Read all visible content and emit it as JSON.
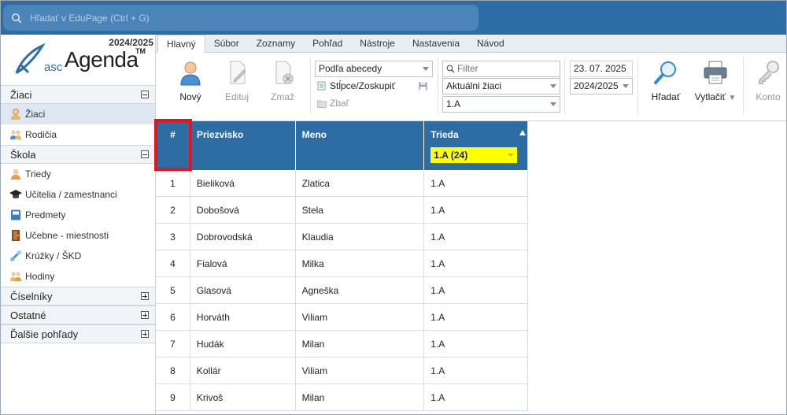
{
  "search": {
    "placeholder": "Hľadať v EduPage (Ctrl + G)"
  },
  "logo": {
    "year": "2024/2025",
    "asc": "asc",
    "agenda": "Agenda",
    "tm": "TM"
  },
  "sidebar": {
    "sections": [
      {
        "title": "Žiaci",
        "state": "minus",
        "items": [
          {
            "label": "Žiaci",
            "icon": "student-icon",
            "active": true
          },
          {
            "label": "Rodičia",
            "icon": "parents-icon"
          }
        ]
      },
      {
        "title": "Škola",
        "state": "minus",
        "items": [
          {
            "label": "Triedy",
            "icon": "class-icon"
          },
          {
            "label": "Učitelia / zamestnanci",
            "icon": "graduation-cap-icon"
          },
          {
            "label": "Predmety",
            "icon": "book-icon"
          },
          {
            "label": "Učebne - miestnosti",
            "icon": "door-icon"
          },
          {
            "label": "Krúžky / ŠKD",
            "icon": "club-icon"
          },
          {
            "label": "Hodiny",
            "icon": "lessons-icon"
          }
        ]
      },
      {
        "title": "Číselníky",
        "state": "plus",
        "items": []
      },
      {
        "title": "Ostatné",
        "state": "plus",
        "items": []
      },
      {
        "title": "Ďalšie pohľady",
        "state": "plus",
        "items": []
      }
    ]
  },
  "ribbon": {
    "tabs": [
      "Hlavný",
      "Súbor",
      "Zoznamy",
      "Pohľad",
      "Nástroje",
      "Nastavenia",
      "Návod"
    ],
    "active_tab": "Hlavný",
    "new_label": "Nový",
    "edit_label": "Edituj",
    "delete_label": "Zmaž",
    "sort_select": "Podľa abecedy",
    "columns_group_label": "Stĺpce/Zoskupiť",
    "collapse_label": "Zbaľ",
    "filter_placeholder": "Filter",
    "students_select": "Aktuálni žiaci",
    "class_select": "1.A",
    "date_value": "23. 07. 2025",
    "year_select": "2024/2025",
    "search_label": "Hľadať",
    "print_label": "Vytlačiť",
    "account_label": "Konto"
  },
  "table": {
    "headers": [
      "#",
      "Priezvisko",
      "Meno",
      "Trieda"
    ],
    "class_filter": "1.A (24)",
    "rows": [
      [
        "1",
        "Bieliková",
        "Zlatica",
        "1.A"
      ],
      [
        "2",
        "Dobošová",
        "Stela",
        "1.A"
      ],
      [
        "3",
        "Dobrovodská",
        "Klaudia",
        "1.A"
      ],
      [
        "4",
        "Fialová",
        "Milka",
        "1.A"
      ],
      [
        "5",
        "Glasová",
        "Agneška",
        "1.A"
      ],
      [
        "6",
        "Horváth",
        "Viliam",
        "1.A"
      ],
      [
        "7",
        "Hudák",
        "Milan",
        "1.A"
      ],
      [
        "8",
        "Kollár",
        "Viliam",
        "1.A"
      ],
      [
        "9",
        "Krivoš",
        "Milan",
        "1.A"
      ]
    ]
  },
  "colors": {
    "accent": "#2e6da4",
    "highlight": "#e8141b",
    "filter": "#ffff00"
  }
}
